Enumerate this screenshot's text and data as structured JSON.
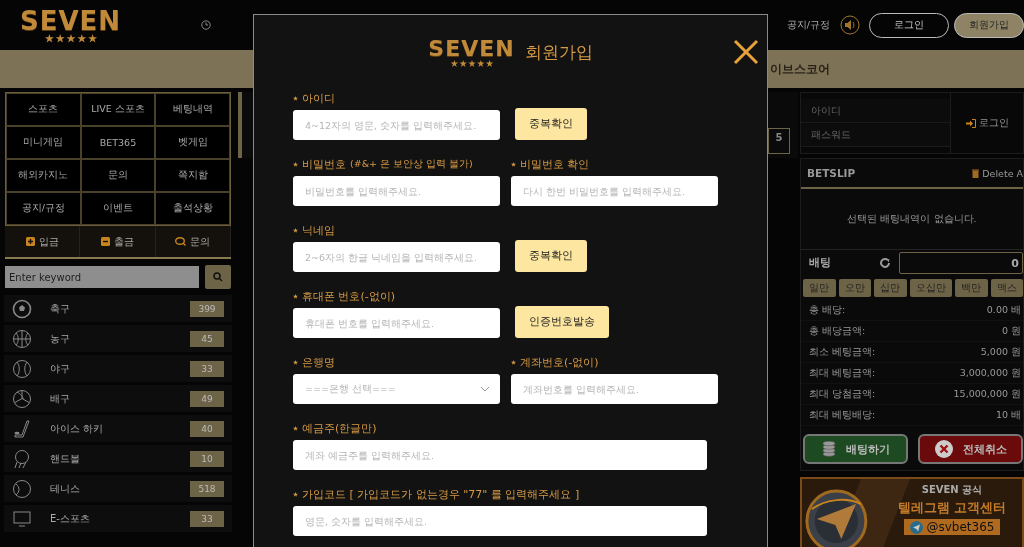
{
  "header": {
    "logo": "SEVEN",
    "links": [
      "공지/규정"
    ],
    "buttons": [
      {
        "kind": "outline",
        "label": "로그인"
      },
      {
        "kind": "filled",
        "label": "회원가입"
      }
    ]
  },
  "nav": {
    "items": [
      "이브스코어"
    ]
  },
  "sidebar": {
    "menu": [
      [
        "스포츠",
        "LIVE 스포츠",
        "베팅내역"
      ],
      [
        "미니게임",
        "BET365",
        "벳게임"
      ],
      [
        "해외카지노",
        "문의",
        "쪽지함"
      ],
      [
        "공지/규정",
        "이벤트",
        "출석상황"
      ]
    ],
    "actions": [
      {
        "kind": "plus",
        "label": "입금"
      },
      {
        "kind": "minus",
        "label": "출금"
      },
      {
        "kind": "chat",
        "label": "문의"
      }
    ],
    "search": {
      "placeholder": "Enter keyword"
    },
    "sports": [
      {
        "kind": "soccer",
        "name": "축구",
        "count": "399"
      },
      {
        "kind": "basketball",
        "name": "농구",
        "count": "45"
      },
      {
        "kind": "baseball",
        "name": "야구",
        "count": "33"
      },
      {
        "kind": "volleyball",
        "name": "배구",
        "count": "49"
      },
      {
        "kind": "hockey",
        "name": "아이스 하키",
        "count": "40"
      },
      {
        "kind": "handball",
        "name": "핸드볼",
        "count": "10"
      },
      {
        "kind": "tennis",
        "name": "테니스",
        "count": "518"
      },
      {
        "kind": "esports",
        "name": "E-스포츠",
        "count": "33"
      }
    ]
  },
  "center": {
    "page_badge": "5"
  },
  "right": {
    "login": {
      "id_placeholder": "아이디",
      "pw_placeholder": "패스워드",
      "button": "로그인"
    },
    "betslip": {
      "title": "BETSLIP",
      "delete": "Delete A",
      "empty": "선택된 배팅내역이 없습니다.",
      "bet_label": "배팅",
      "bet_value": "0",
      "amounts": [
        "일만",
        "오만",
        "십만",
        "오십만",
        "백만",
        "맥스"
      ],
      "summary": [
        {
          "label": "총 배당:",
          "value": "0.00 배"
        },
        {
          "label": "총 배당금액:",
          "value": "0 원"
        },
        {
          "label": "최소 베팅금액:",
          "value": "5,000 원"
        },
        {
          "label": "최대 베팅금액:",
          "value": "3,000,000 원"
        },
        {
          "label": "최대 당첨금액:",
          "value": "15,000,000 원"
        },
        {
          "label": "최대 베팅배당:",
          "value": "10 배"
        }
      ],
      "place": "배팅하기",
      "cancel": "전체취소"
    },
    "banner": {
      "line1": "SEVEN 공식",
      "line2": "텔레그램 고객센터",
      "handle": "@svbet365"
    }
  },
  "modal": {
    "logo": "SEVEN",
    "title": "회원가입",
    "rows": [
      [
        {
          "kind": "text",
          "label": "아이디",
          "placeholder": "4~12자의 영문, 숫자를 입력해주세요.",
          "button": "중복확인"
        }
      ],
      [
        {
          "kind": "text",
          "label": "비밀번호",
          "note": "(#&+ 은 보안상 입력 불가)",
          "placeholder": "비밀번호를 입력해주세요."
        },
        {
          "kind": "text",
          "label": "비밀번호 확인",
          "placeholder": "다시 한번 비밀번호를 입력해주세요."
        }
      ],
      [
        {
          "kind": "text",
          "label": "닉네임",
          "placeholder": "2~6자의 한글 닉네임을 입력해주세요.",
          "button": "중복확인"
        }
      ],
      [
        {
          "kind": "text",
          "label": "휴대폰 번호(-없이)",
          "placeholder": "휴대폰 번호를 입력해주세요.",
          "button": "인증번호발송"
        }
      ],
      [
        {
          "kind": "select",
          "label": "은행명",
          "placeholder": "===은행 선택==="
        },
        {
          "kind": "text",
          "label": "계좌번호(-없이)",
          "placeholder": "계좌번호를 입력해주세요."
        }
      ],
      [
        {
          "kind": "text",
          "label": "예금주(한글만)",
          "placeholder": "계좌 예금주를 입력해주세요."
        }
      ],
      [
        {
          "kind": "text",
          "label": "가입코드 [ 가입코드가 없는경우 \"77\" 를 입력해주세요 ]",
          "placeholder": "영문, 숫자를 입력해주세요."
        }
      ]
    ]
  }
}
